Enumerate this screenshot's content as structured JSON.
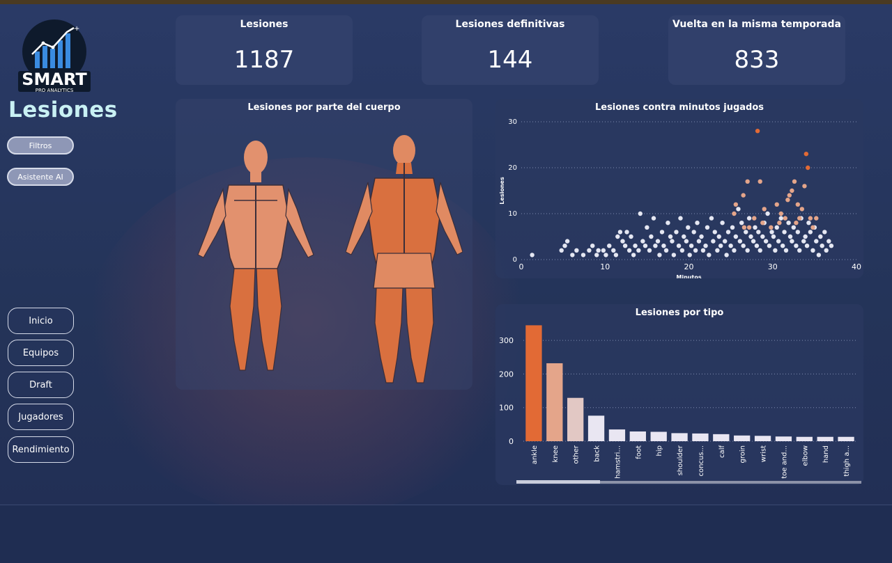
{
  "brand": {
    "logo_text": "SMART",
    "logo_sub": "PRO ANALYTICS",
    "page_title": "Lesiones"
  },
  "buttons": {
    "filters": "Filtros",
    "ai": "Asistente AI"
  },
  "nav": [
    {
      "label": "Inicio"
    },
    {
      "label": "Equipos"
    },
    {
      "label": "Draft"
    },
    {
      "label": "Jugadores"
    },
    {
      "label": "Rendimiento"
    }
  ],
  "kpis": [
    {
      "label": "Lesiones",
      "value": "1187"
    },
    {
      "label": "Lesiones definitivas",
      "value": "144"
    },
    {
      "label": "Vuelta en la misma temporada",
      "value": "833"
    }
  ],
  "body_panel": {
    "title": "Lesiones por parte del cuerpo"
  },
  "colors": {
    "accent": "#e26a35",
    "mid": "#e4a58a",
    "light": "#e2c8c4",
    "pale": "#e9e6f2",
    "body_front": "#e2916e",
    "body_back": "#d9703f"
  },
  "chart_data": [
    {
      "type": "scatter",
      "title": "Lesiones contra minutos jugados",
      "xlabel": "Minutos",
      "ylabel": "Lesiones",
      "xlim": [
        0,
        40
      ],
      "ylim": [
        0,
        30
      ],
      "xticks": [
        0,
        10,
        20,
        30,
        40
      ],
      "yticks": [
        0,
        10,
        20,
        30
      ],
      "grid": true,
      "points": [
        [
          1.3,
          1
        ],
        [
          4.8,
          2
        ],
        [
          5.2,
          3
        ],
        [
          5.5,
          4
        ],
        [
          6.1,
          1
        ],
        [
          6.6,
          2
        ],
        [
          7.4,
          1
        ],
        [
          8.1,
          2
        ],
        [
          8.5,
          3
        ],
        [
          9.0,
          1
        ],
        [
          9.2,
          2
        ],
        [
          9.8,
          2
        ],
        [
          10.1,
          1
        ],
        [
          10.5,
          3
        ],
        [
          11.0,
          2
        ],
        [
          11.3,
          1
        ],
        [
          11.5,
          5
        ],
        [
          11.8,
          6
        ],
        [
          12.1,
          4
        ],
        [
          12.4,
          3
        ],
        [
          12.6,
          6
        ],
        [
          12.9,
          2
        ],
        [
          13.1,
          5
        ],
        [
          13.4,
          1
        ],
        [
          13.6,
          3
        ],
        [
          14.0,
          2
        ],
        [
          14.2,
          10
        ],
        [
          14.5,
          4
        ],
        [
          14.8,
          3
        ],
        [
          15.0,
          7
        ],
        [
          15.3,
          2
        ],
        [
          15.5,
          5
        ],
        [
          15.8,
          9
        ],
        [
          16.0,
          3
        ],
        [
          16.3,
          4
        ],
        [
          16.5,
          1
        ],
        [
          16.8,
          6
        ],
        [
          17.0,
          3
        ],
        [
          17.3,
          2
        ],
        [
          17.5,
          8
        ],
        [
          17.8,
          5
        ],
        [
          18.0,
          4
        ],
        [
          18.2,
          1
        ],
        [
          18.5,
          6
        ],
        [
          18.8,
          3
        ],
        [
          19.0,
          9
        ],
        [
          19.2,
          2
        ],
        [
          19.4,
          5
        ],
        [
          19.7,
          4
        ],
        [
          19.9,
          7
        ],
        [
          20.1,
          1
        ],
        [
          20.3,
          3
        ],
        [
          20.6,
          6
        ],
        [
          20.8,
          2
        ],
        [
          21.0,
          8
        ],
        [
          21.2,
          4
        ],
        [
          21.5,
          5
        ],
        [
          21.7,
          2
        ],
        [
          22.0,
          3
        ],
        [
          22.2,
          7
        ],
        [
          22.4,
          1
        ],
        [
          22.7,
          9
        ],
        [
          22.9,
          4
        ],
        [
          23.1,
          6
        ],
        [
          23.4,
          2
        ],
        [
          23.6,
          5
        ],
        [
          23.8,
          3
        ],
        [
          24.0,
          8
        ],
        [
          24.3,
          4
        ],
        [
          24.5,
          1
        ],
        [
          24.7,
          6
        ],
        [
          25.0,
          3
        ],
        [
          25.2,
          7
        ],
        [
          25.4,
          2
        ],
        [
          25.6,
          5
        ],
        [
          25.9,
          11
        ],
        [
          26.1,
          4
        ],
        [
          26.3,
          8
        ],
        [
          26.5,
          3
        ],
        [
          26.8,
          6
        ],
        [
          27.0,
          2
        ],
        [
          27.2,
          9
        ],
        [
          27.4,
          5
        ],
        [
          27.7,
          4
        ],
        [
          27.9,
          7
        ],
        [
          28.1,
          3
        ],
        [
          28.3,
          6
        ],
        [
          28.5,
          2
        ],
        [
          28.8,
          5
        ],
        [
          29.0,
          8
        ],
        [
          29.2,
          4
        ],
        [
          29.4,
          10
        ],
        [
          29.6,
          3
        ],
        [
          29.9,
          6
        ],
        [
          30.1,
          5
        ],
        [
          30.3,
          2
        ],
        [
          30.5,
          7
        ],
        [
          30.7,
          4
        ],
        [
          31.0,
          9
        ],
        [
          31.2,
          3
        ],
        [
          31.4,
          6
        ],
        [
          31.6,
          2
        ],
        [
          31.9,
          8
        ],
        [
          32.1,
          5
        ],
        [
          32.3,
          4
        ],
        [
          32.5,
          7
        ],
        [
          32.8,
          3
        ],
        [
          33.0,
          6
        ],
        [
          33.2,
          2
        ],
        [
          33.4,
          9
        ],
        [
          33.7,
          4
        ],
        [
          33.9,
          5
        ],
        [
          34.1,
          3
        ],
        [
          34.3,
          8
        ],
        [
          34.5,
          6
        ],
        [
          34.8,
          2
        ],
        [
          35.0,
          7
        ],
        [
          35.2,
          4
        ],
        [
          35.5,
          1
        ],
        [
          35.7,
          5
        ],
        [
          35.9,
          3
        ],
        [
          36.2,
          6
        ],
        [
          36.4,
          2
        ],
        [
          36.7,
          4
        ],
        [
          37.0,
          3
        ]
      ],
      "highlight_points": [
        [
          25.4,
          10
        ],
        [
          25.6,
          12
        ],
        [
          26.5,
          14
        ],
        [
          27.0,
          17
        ],
        [
          27.8,
          9
        ],
        [
          28.2,
          28
        ],
        [
          28.5,
          17
        ],
        [
          29.0,
          11
        ],
        [
          30.5,
          12
        ],
        [
          31.0,
          10
        ],
        [
          31.8,
          13
        ],
        [
          32.0,
          14
        ],
        [
          32.3,
          15
        ],
        [
          32.6,
          17
        ],
        [
          33.0,
          12
        ],
        [
          33.5,
          11
        ],
        [
          33.8,
          16
        ],
        [
          34.0,
          23
        ],
        [
          34.2,
          20
        ],
        [
          34.5,
          9
        ],
        [
          34.8,
          7
        ],
        [
          35.2,
          9
        ],
        [
          32.8,
          8
        ],
        [
          30.8,
          8
        ],
        [
          29.8,
          7
        ],
        [
          28.8,
          8
        ],
        [
          27.2,
          7
        ],
        [
          26.6,
          7
        ],
        [
          33.2,
          9
        ],
        [
          31.5,
          9
        ]
      ]
    },
    {
      "type": "bar",
      "title": "Lesiones por tipo",
      "categories": [
        "ankle",
        "knee",
        "other",
        "back",
        "hamstri...",
        "foot",
        "hip",
        "shoulder",
        "concus...",
        "calf",
        "groin",
        "wrist",
        "toe and...",
        "elbow",
        "hand",
        "thigh a..."
      ],
      "values": [
        345,
        232,
        129,
        76,
        35,
        29,
        28,
        24,
        23,
        21,
        17,
        16,
        14,
        13,
        13,
        13
      ],
      "ylim": [
        0,
        350
      ],
      "yticks": [
        0,
        100,
        200,
        300
      ],
      "grid": true
    }
  ]
}
